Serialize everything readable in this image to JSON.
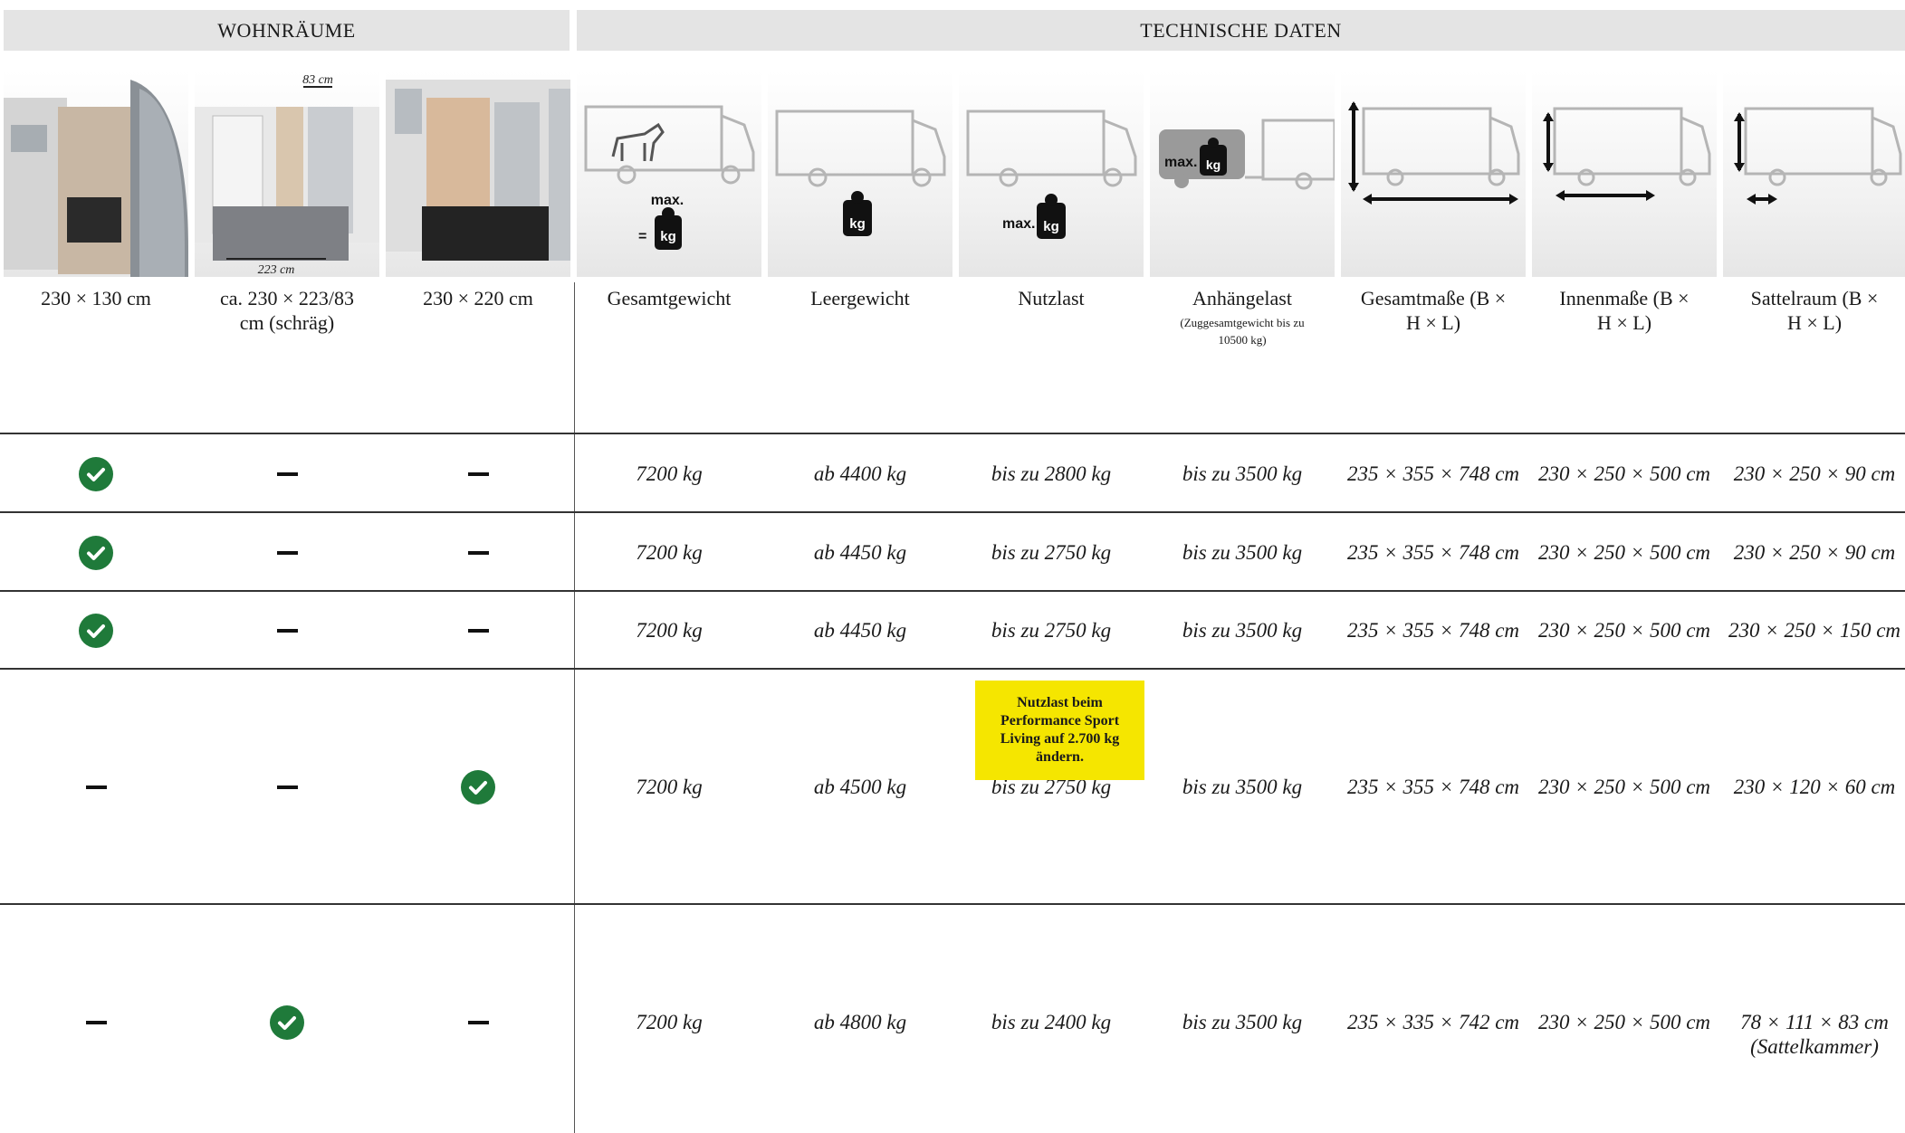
{
  "headers": {
    "wohnraeume": "WOHNRÄUME",
    "technische_daten": "TECHNISCHE DATEN"
  },
  "thumbs": {
    "dim_top": "83 cm",
    "dim_bottom": "223 cm",
    "icon_max": "max.",
    "icon_eq": "=",
    "icon_kg": "kg"
  },
  "columns": [
    {
      "label": "230 × 130 cm"
    },
    {
      "label": "ca. 230 × 223/83 cm (schräg)"
    },
    {
      "label": "230 × 220 cm"
    },
    {
      "label": "Gesamtgewicht"
    },
    {
      "label": "Leergewicht"
    },
    {
      "label": "Nutzlast"
    },
    {
      "label": "Anhängelast",
      "sub": "(Zuggesamtgewicht bis zu 10500 kg)"
    },
    {
      "label": "Gesamtmaße (B × H × L)"
    },
    {
      "label": "Innenmaße (B × H × L)"
    },
    {
      "label": "Sattelraum (B × H × L)"
    }
  ],
  "rows": [
    {
      "layout": [
        "check",
        "dash",
        "dash"
      ],
      "gesamt": "7200 kg",
      "leer": "ab 4400 kg",
      "nutz": "bis zu 2800 kg",
      "anh": "bis zu 3500 kg",
      "gmasse": "235 × 355 × 748 cm",
      "imasse": "230 × 250 × 500 cm",
      "sattel": "230 × 250 × 90 cm"
    },
    {
      "layout": [
        "check",
        "dash",
        "dash"
      ],
      "gesamt": "7200 kg",
      "leer": "ab 4450 kg",
      "nutz": "bis zu 2750 kg",
      "anh": "bis zu 3500 kg",
      "gmasse": "235 × 355 × 748 cm",
      "imasse": "230 × 250 × 500 cm",
      "sattel": "230 × 250 × 90 cm"
    },
    {
      "layout": [
        "check",
        "dash",
        "dash"
      ],
      "gesamt": "7200 kg",
      "leer": "ab 4450 kg",
      "nutz": "bis zu 2750 kg",
      "anh": "bis zu 3500 kg",
      "gmasse": "235 × 355 × 748 cm",
      "imasse": "230 × 250 × 500 cm",
      "sattel": "230 × 250 × 150 cm"
    },
    {
      "layout": [
        "dash",
        "dash",
        "check"
      ],
      "gesamt": "7200 kg",
      "leer": "ab 4500 kg",
      "nutz": "bis zu 2750 kg",
      "anh": "bis zu 3500 kg",
      "gmasse": "235 × 355 × 748 cm",
      "imasse": "230 × 250 × 500 cm",
      "sattel": "230 × 120 × 60 cm"
    },
    {
      "layout": [
        "dash",
        "check",
        "dash"
      ],
      "gesamt": "7200 kg",
      "leer": "ab 4800 kg",
      "nutz": "bis zu 2400 kg",
      "anh": "bis zu 3500 kg",
      "gmasse": "235 × 335 × 742 cm",
      "imasse": "230 × 250 × 500 cm",
      "sattel": "78 × 111 × 83 cm (Sattelkammer)"
    }
  ],
  "note": "Nutzlast beim Performance Sport Living auf 2.700 kg ändern.",
  "colors": {
    "check": "#1f7a3a",
    "note_bg": "#f5e600",
    "header_bg": "#e4e4e4"
  }
}
